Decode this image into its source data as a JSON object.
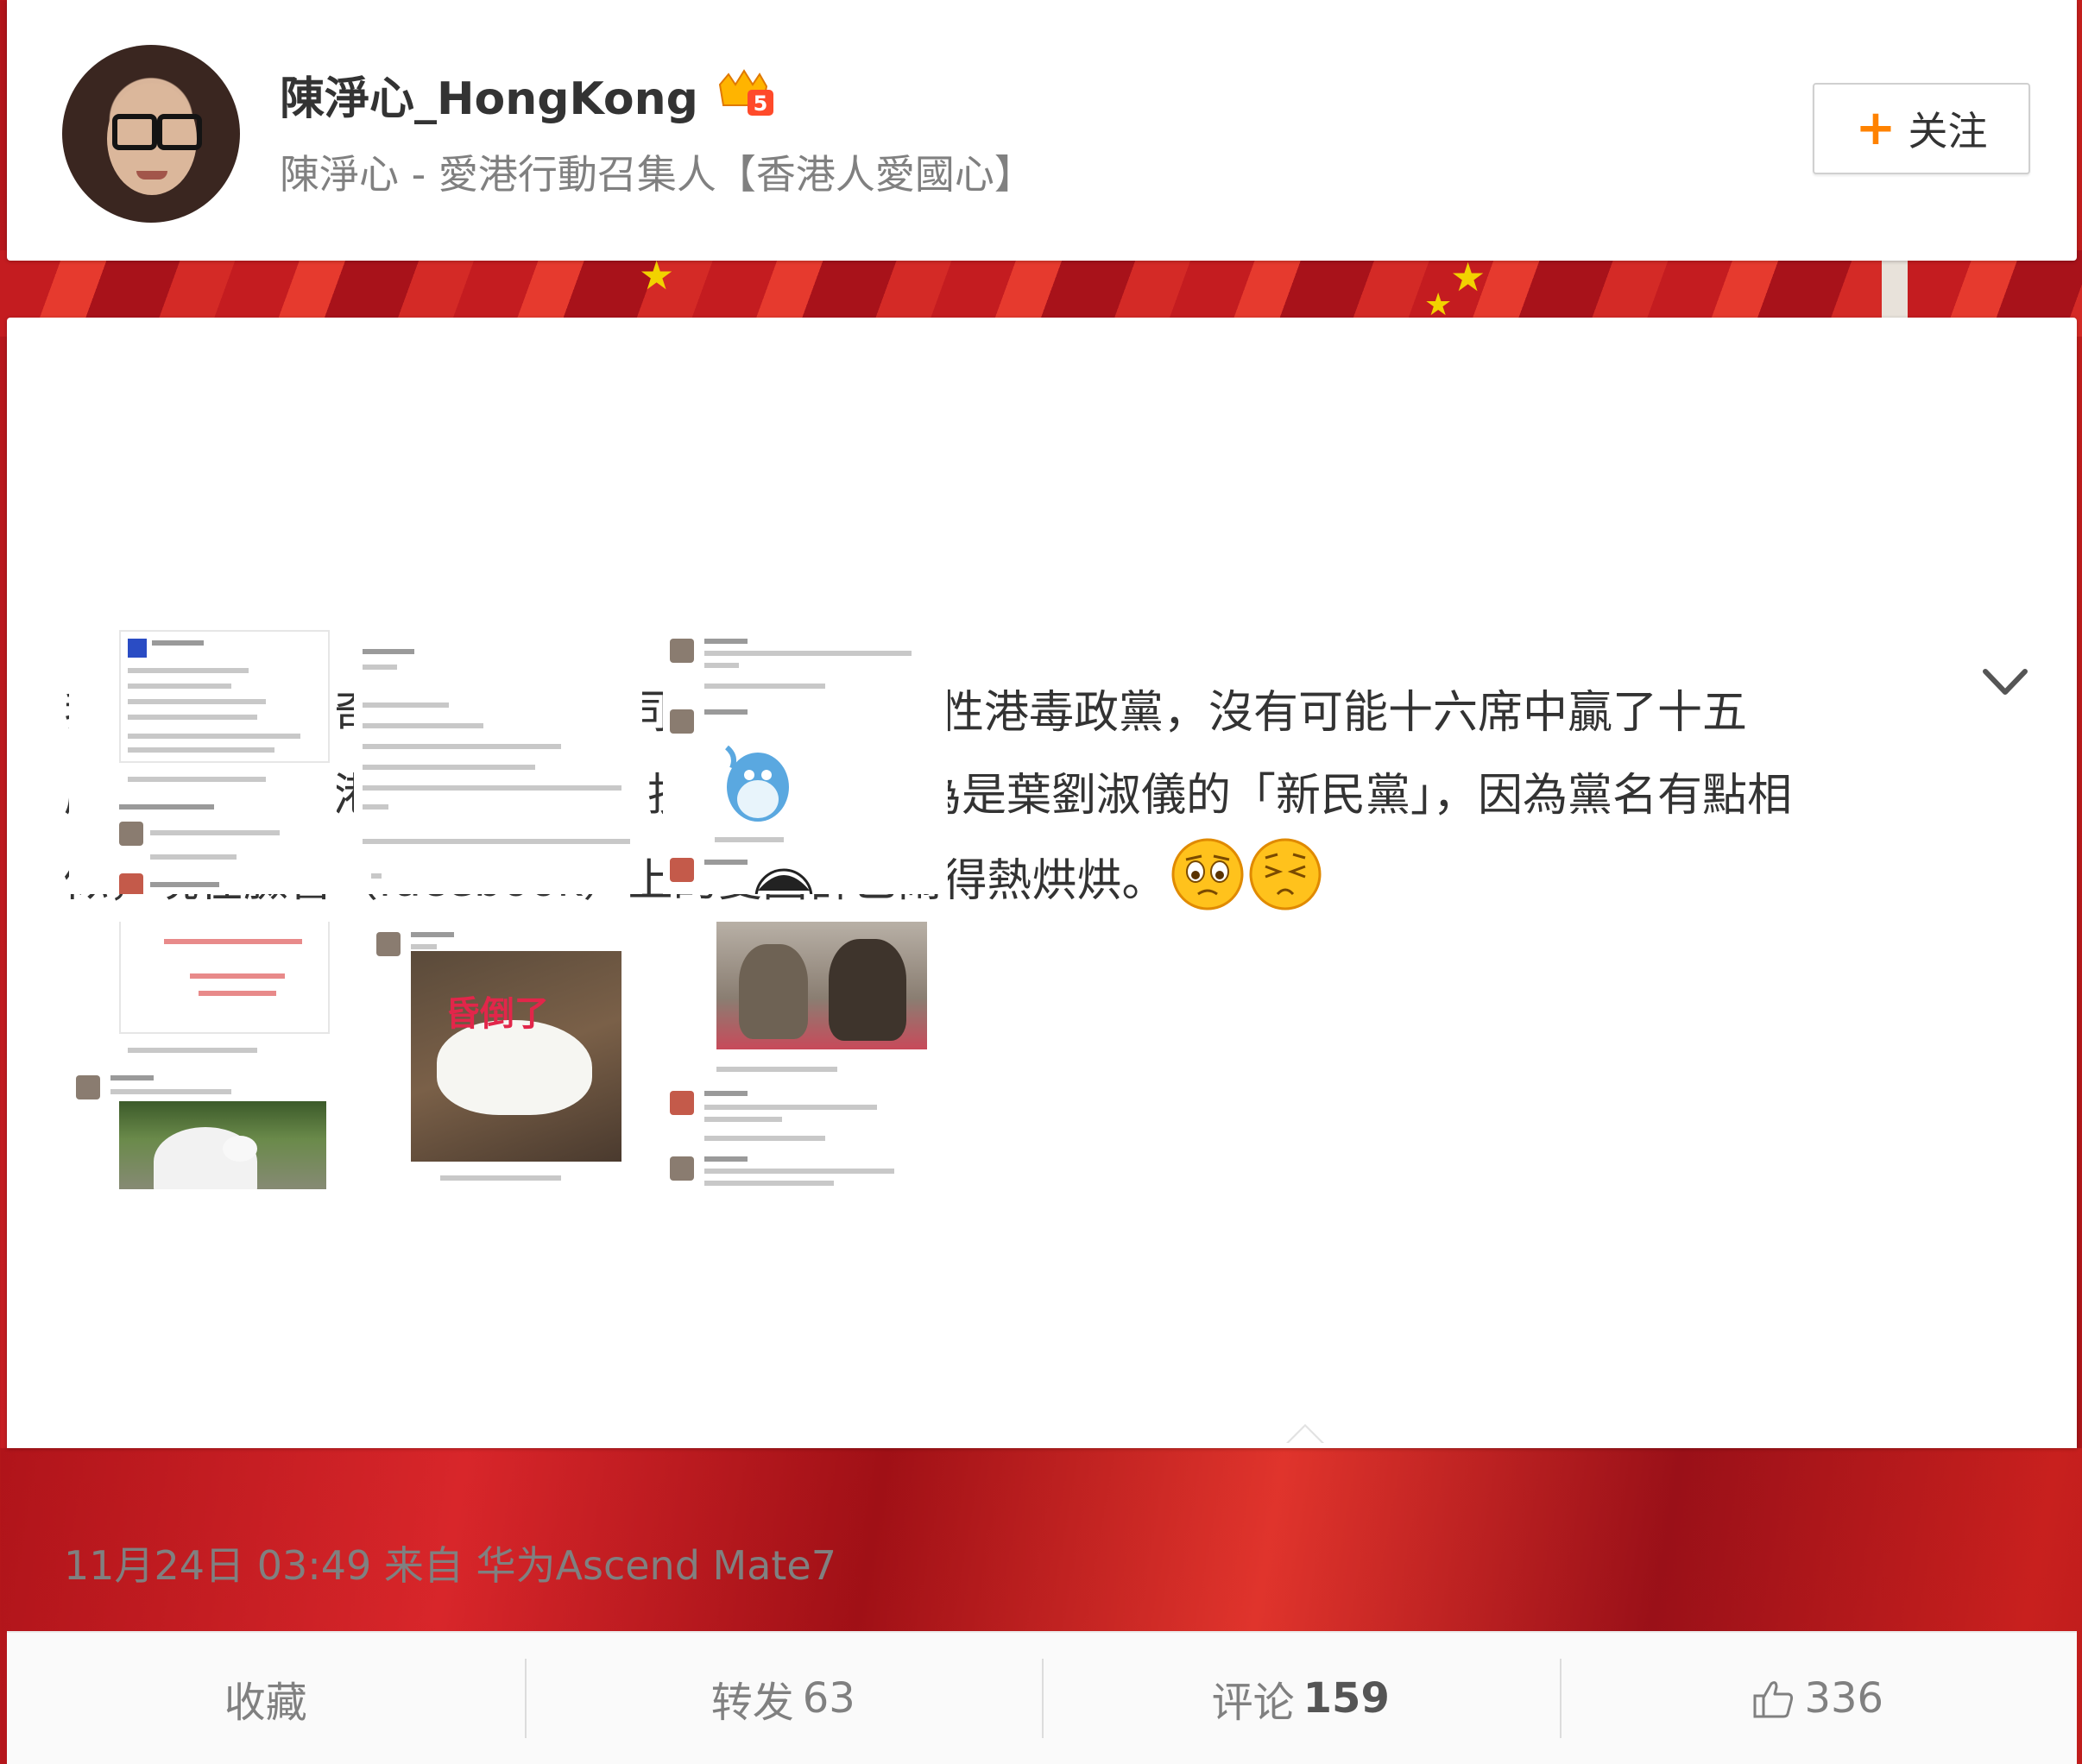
{
  "profile": {
    "username": "陳淨心_HongKong",
    "description": "陳淨心 - 愛港行動召集人【香港人愛國心】",
    "badge_icon": "vip-crown-5-icon",
    "follow_label": "关注",
    "follow_icon": "plus-icon"
  },
  "post": {
    "lines": [
      "我一早已覺得奇怪，「新民主同盟」明明是隱性港毒政黨，沒有可能十六席中贏了十五",
      "席，原來很多港人都搞錯了，投錯票，誤以為是葉劉淑儀的「新民黨」，因為黨名有點相",
      "似，現在臉書（facebook）上的愛國群已鬧得熱烘烘。"
    ],
    "emoticons": [
      "sad-face-emoticon",
      "sigh-face-emoticon"
    ],
    "thumbnails": [
      {
        "watermark": "",
        "caption": ""
      },
      {
        "watermark": "",
        "caption": ""
      },
      {
        "watermark": "",
        "caption": ""
      },
      {
        "watermark": "",
        "caption": ""
      },
      {
        "watermark": "",
        "caption": ""
      },
      {
        "watermark": "",
        "caption": ""
      }
    ],
    "date": "11月24日 03:49",
    "source_prefix": "来自",
    "source": "华为Ascend Mate7"
  },
  "actions": {
    "favorite": "收藏",
    "repost": "转发",
    "repost_count": "63",
    "comment": "评论",
    "comment_count": "159",
    "like_count": "336"
  },
  "colors": {
    "accent": "#ff8200",
    "text": "#333333",
    "muted": "#808080"
  }
}
